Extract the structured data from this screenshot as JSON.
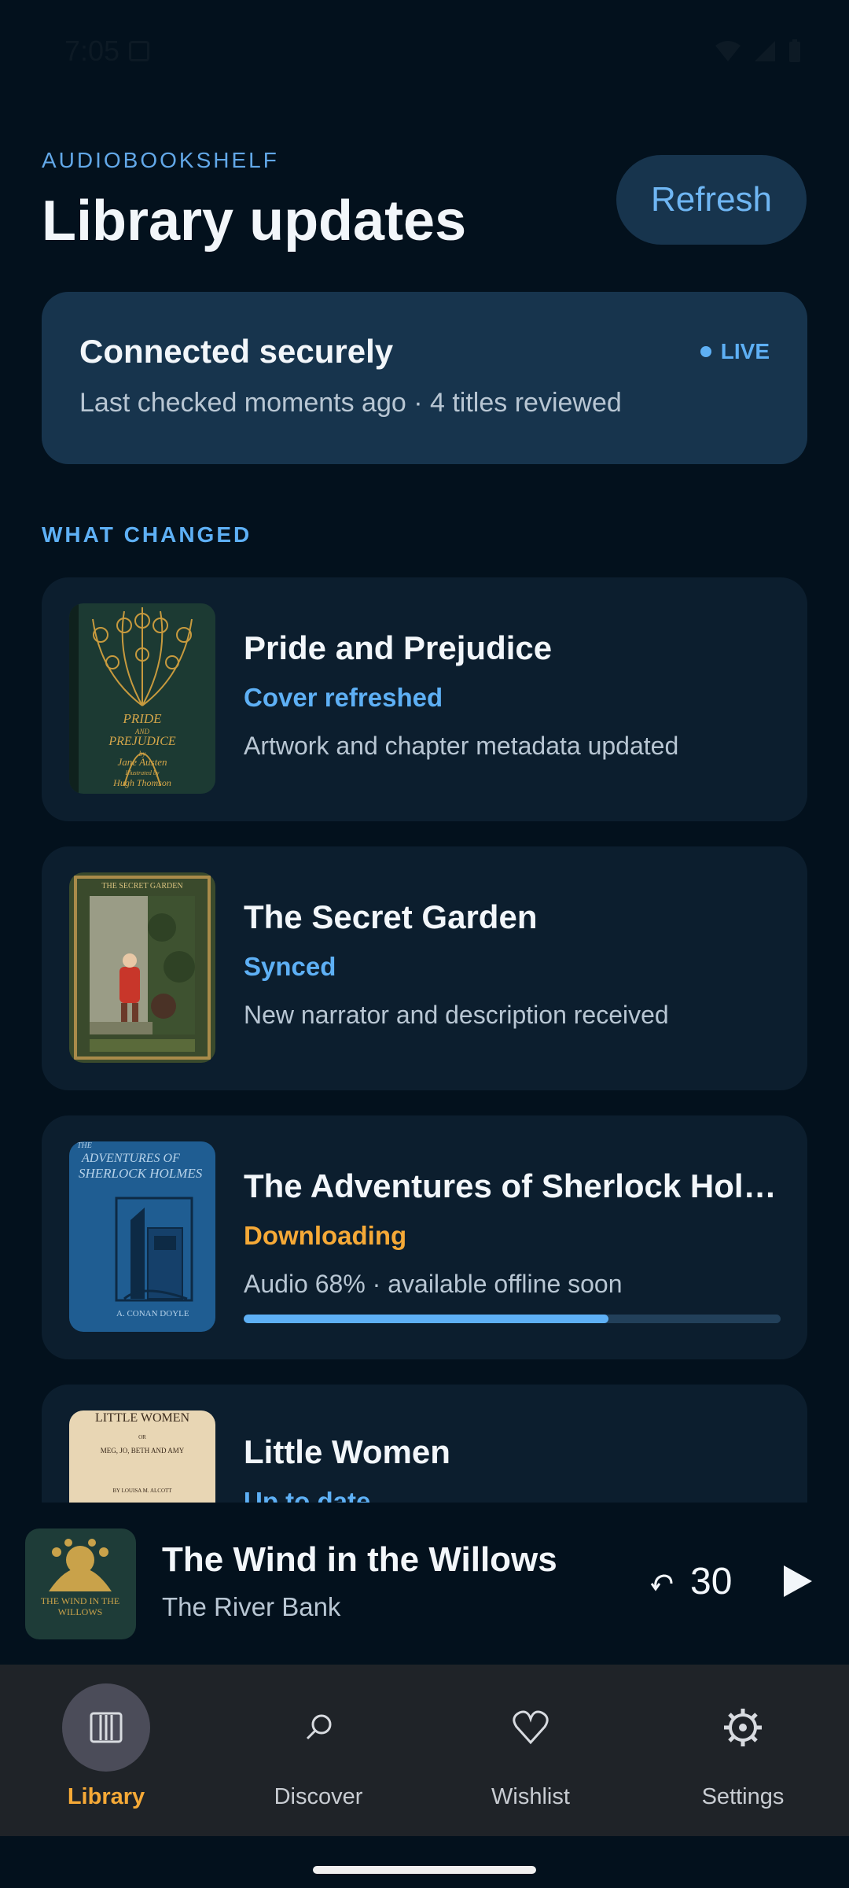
{
  "status_bar": {
    "time": "7:05"
  },
  "header": {
    "brand": "AUDIOBOOKSHELF",
    "title": "Library updates",
    "refresh_label": "Refresh"
  },
  "connection": {
    "title": "Connected securely",
    "subtitle": "Last checked moments ago · 4 titles reviewed",
    "badge": "LIVE"
  },
  "section_label": "WHAT CHANGED",
  "books": [
    {
      "title": "Pride and Prejudice",
      "status": "Cover refreshed",
      "desc": "Artwork and chapter metadata updated"
    },
    {
      "title": "The Secret Garden",
      "status": "Synced",
      "desc": "New narrator and description received"
    },
    {
      "title": "The Adventures of Sherlock Holmes",
      "status": "Downloading",
      "desc": "Audio 68% · available offline soon",
      "progress": 0.68
    },
    {
      "title": "Little Women",
      "status": "Up to date"
    }
  ],
  "covers": {
    "pride": {
      "lines": [
        "PRIDE",
        "AND",
        "PREJUDICE",
        "by",
        "Jane Austen",
        "Illustrated by",
        "Hugh Thomson"
      ]
    },
    "secret": {
      "header": "THE SECRET GARDEN"
    },
    "sherlock": {
      "line1": "ADVENTURES OF",
      "line2": "SHERLOCK HOLMES",
      "author": "A. CONAN DOYLE",
      "prefix": "THE"
    },
    "little_women": {
      "title": "LITTLE WOMEN",
      "line1": "OR",
      "line2": "MEG, JO, BETH AND AMY",
      "line3": "BY LOUISA M. ALCOTT"
    },
    "willows": {
      "line1": "THE WIND IN THE",
      "line2": "WILLOWS"
    }
  },
  "player": {
    "title": "The Wind in the Willows",
    "chapter": "The River Bank",
    "rewind_seconds": "30"
  },
  "nav": [
    {
      "label": "Library"
    },
    {
      "label": "Discover"
    },
    {
      "label": "Wishlist"
    },
    {
      "label": "Settings"
    }
  ],
  "colors": {
    "accent_blue": "#5eb0f5",
    "accent_orange": "#f5a937",
    "background": "#03111d",
    "card": "#0c1e2e",
    "status_card": "#17344d"
  }
}
